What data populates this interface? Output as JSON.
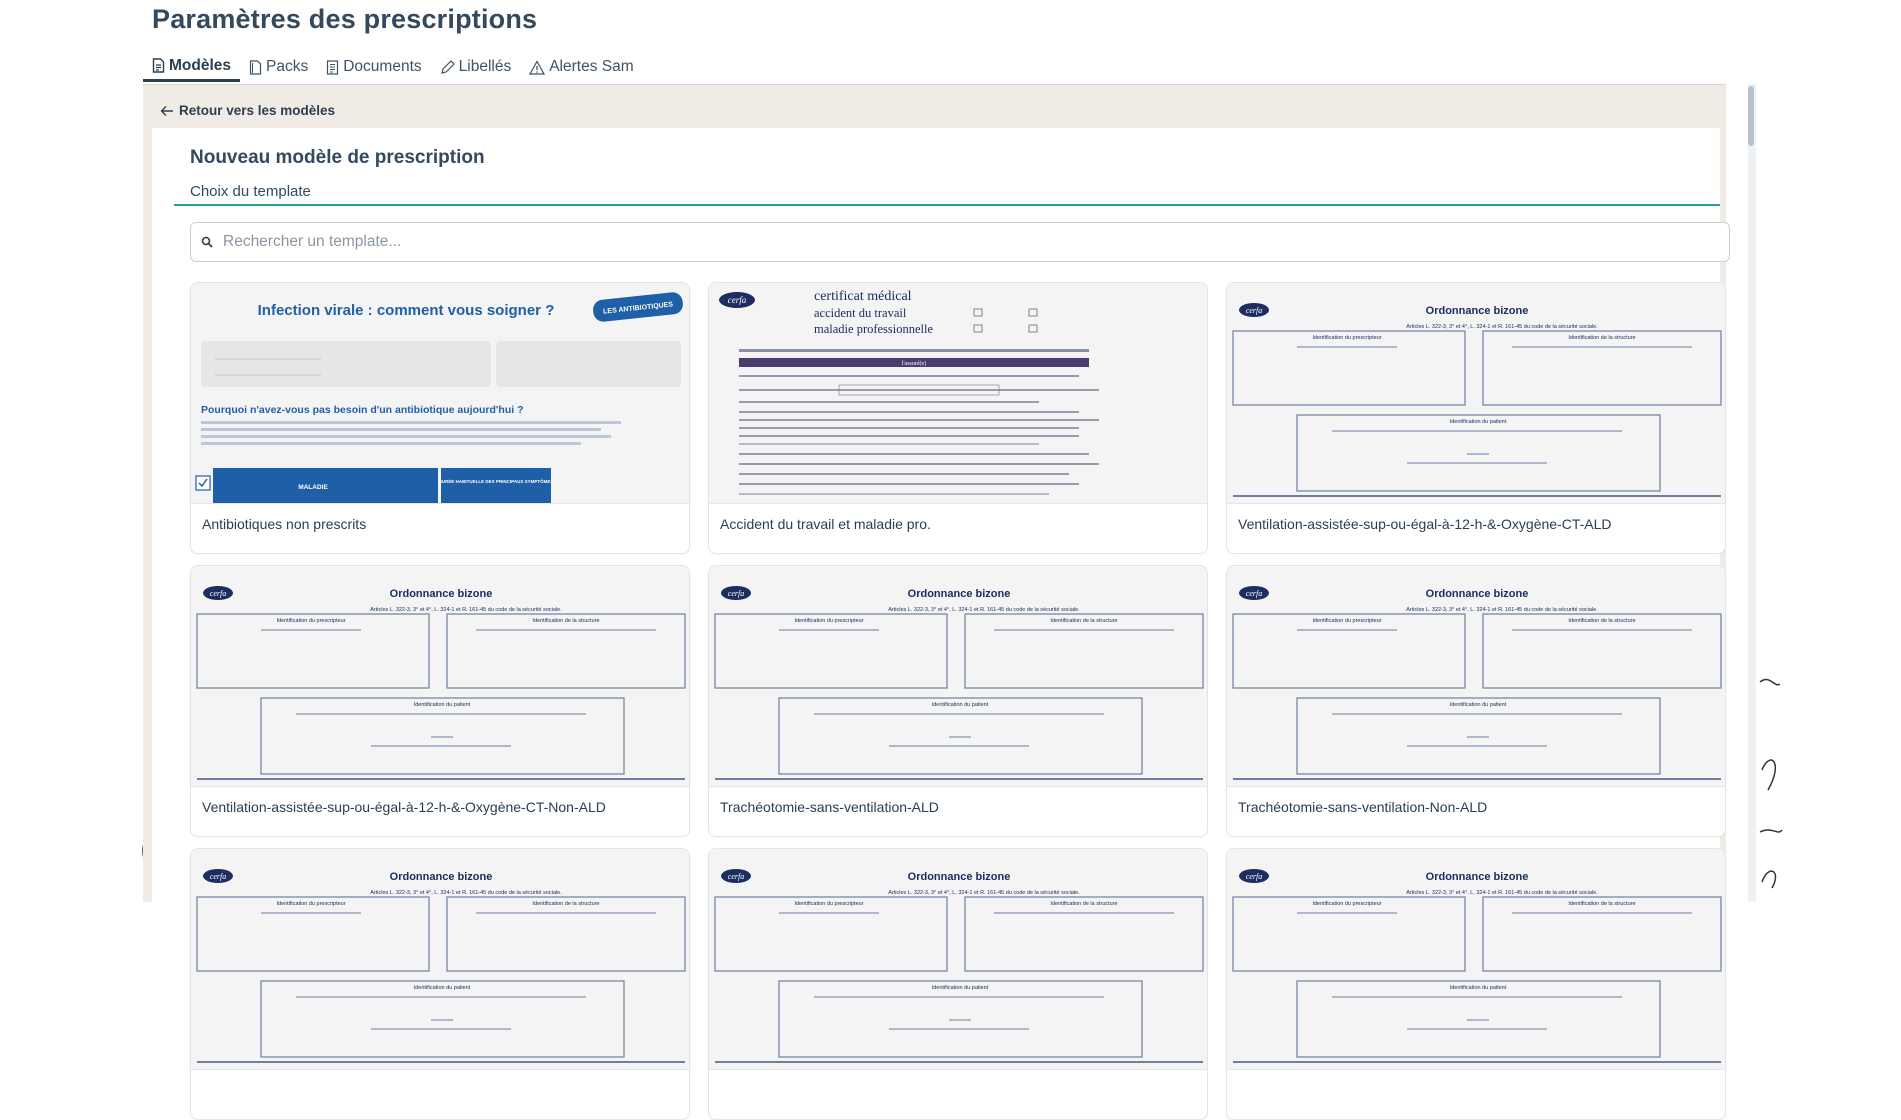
{
  "header": {
    "title": "Paramètres des prescriptions"
  },
  "tabs": [
    {
      "label": "Modèles",
      "icon": "file-text-icon",
      "active": true
    },
    {
      "label": "Packs",
      "icon": "file-icon",
      "active": false
    },
    {
      "label": "Documents",
      "icon": "document-icon",
      "active": false
    },
    {
      "label": "Libellés",
      "icon": "pencil-icon",
      "active": false
    },
    {
      "label": "Alertes Sam",
      "icon": "warning-triangle-icon",
      "active": false
    }
  ],
  "back_link": {
    "label": "Retour vers les modèles",
    "icon": "arrow-left-icon"
  },
  "form": {
    "title": "Nouveau modèle de prescription",
    "step": "Choix du template",
    "search": {
      "placeholder": "Rechercher un template...",
      "value": "",
      "icon": "search-icon"
    }
  },
  "thumbnails": {
    "antibio": {
      "title": "Infection virale : comment vous soigner ?",
      "badge": "LES ANTIBIOTIQUES",
      "question": "Pourquoi n'avez-vous pas besoin d'un antibiotique aujourd'hui ?",
      "col1": "MALADIE",
      "col2": "DURÉE HABITUELLE DES PRINCIPAUX SYMPTÔMES"
    },
    "cerfa_at": {
      "logo": "cerfa",
      "title1": "certificat médical",
      "title2": "accident du travail",
      "title3": "maladie professionnelle",
      "banner": "l'assuré(e)"
    },
    "bizone": {
      "logo": "cerfa",
      "title": "Ordonnance bizone",
      "articles": "Articles L. 322-3, 3° et 4°, L. 324-1 et R. 161-45 du code de la sécurité sociale.",
      "box1": "Identification du prescripteur",
      "box2": "Identification de la structure",
      "box3": "Identification du patient"
    }
  },
  "templates": [
    {
      "label": "Antibiotiques non prescrits",
      "type": "antibio"
    },
    {
      "label": "Accident du travail et maladie pro.",
      "type": "cerfa_at"
    },
    {
      "label": "Ventilation-assistée-sup-ou-égal-à-12-h-&-Oxygène-CT-ALD",
      "type": "bizone"
    },
    {
      "label": "Ventilation-assistée-sup-ou-égal-à-12-h-&-Oxygène-CT-Non-ALD",
      "type": "bizone"
    },
    {
      "label": "Trachéotomie-sans-ventilation-ALD",
      "type": "bizone"
    },
    {
      "label": "Trachéotomie-sans-ventilation-Non-ALD",
      "type": "bizone"
    },
    {
      "label": "",
      "type": "bizone"
    },
    {
      "label": "",
      "type": "bizone"
    },
    {
      "label": "",
      "type": "bizone"
    }
  ],
  "colors": {
    "accent": "#2aa198",
    "text": "#2c3e50",
    "background": "#f0ebe5",
    "badge": "#1f5fa8"
  }
}
